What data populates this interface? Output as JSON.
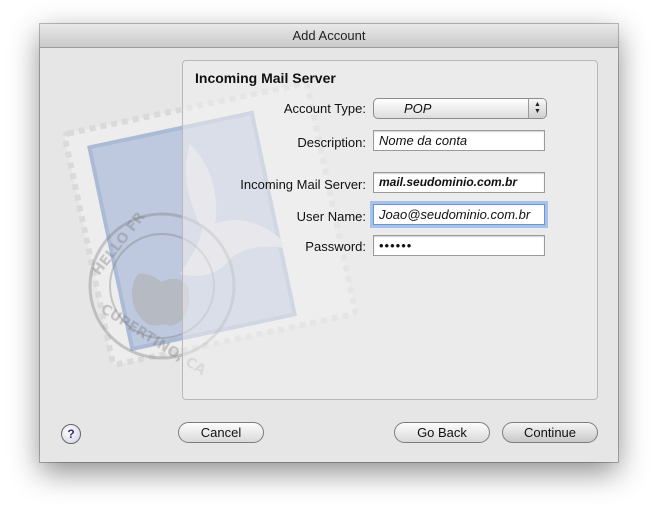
{
  "window": {
    "title": "Add Account"
  },
  "section": {
    "title": "Incoming Mail Server"
  },
  "fields": {
    "account_type": {
      "label": "Account Type:",
      "value": "POP"
    },
    "description": {
      "label": "Description:",
      "value": "Nome da conta"
    },
    "incoming_server": {
      "label": "Incoming Mail Server:",
      "value": "mail.seudominio.com.br"
    },
    "user_name": {
      "label": "User Name:",
      "value": "Joao@seudominio.com.br"
    },
    "password": {
      "label": "Password:",
      "value": "••••••"
    }
  },
  "buttons": {
    "help": "?",
    "cancel": "Cancel",
    "go_back": "Go Back",
    "continue": "Continue"
  },
  "icons": {
    "help": "help-icon",
    "arrows": "updown-arrows-icon",
    "stamp": "mail-stamp-icon"
  }
}
